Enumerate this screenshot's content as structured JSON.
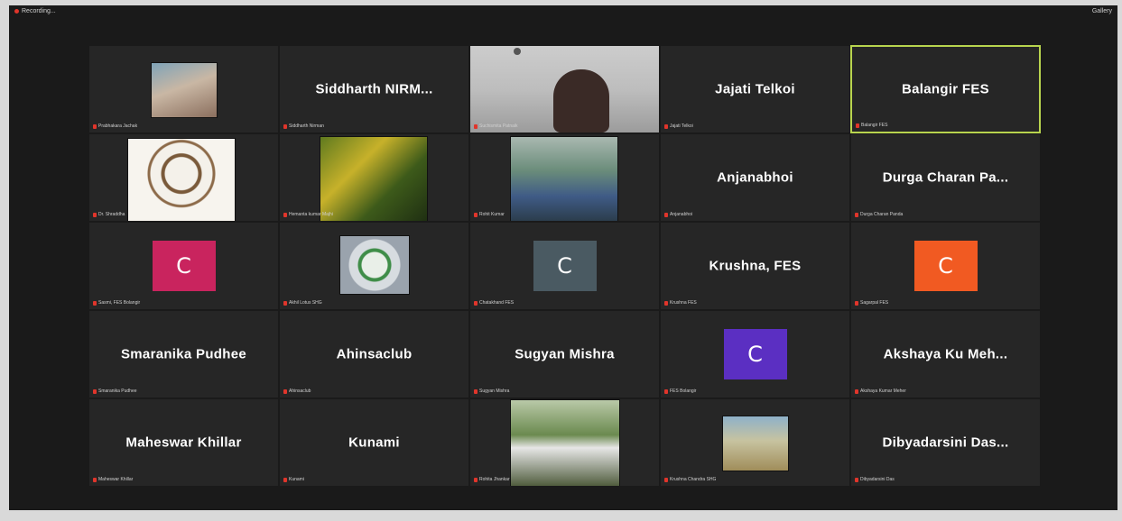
{
  "topbar": {
    "recording_label": "Recording...",
    "view_label": "Gallery"
  },
  "colors": {
    "active_speaker": "#b8d44e",
    "tile_bg": "#262626",
    "muted_mic": "#e0352b"
  },
  "tiles": [
    {
      "kind": "photo",
      "label": "Prabhakara Jachak",
      "photo": "person-portrait"
    },
    {
      "kind": "name",
      "display_name": "Siddharth  NIRM...",
      "label": "Siddharth Nirman"
    },
    {
      "kind": "video",
      "label": "Suchismita Patnaik",
      "active": false
    },
    {
      "kind": "name",
      "display_name": "Jajati Telkoi",
      "label": "Jajati Telkoi"
    },
    {
      "kind": "name",
      "display_name": "Balangir FES",
      "label": "Balangir FES",
      "active": true
    },
    {
      "kind": "photo",
      "label": "Dr. Shraddha",
      "photo": "emblem-logo"
    },
    {
      "kind": "photo",
      "label": "Hemanta kumar Majhi",
      "photo": "person-garden"
    },
    {
      "kind": "photo",
      "label": "Rohit Kumar",
      "photo": "person-sitting"
    },
    {
      "kind": "name",
      "display_name": "Anjanabhoi",
      "label": "Anjanabhoi"
    },
    {
      "kind": "name",
      "display_name": "Durga Charan Pa...",
      "label": "Durga Charan Panda"
    },
    {
      "kind": "letter",
      "letter": "C",
      "color": "#c9245e",
      "label": "Sasmi, FES Bolangir"
    },
    {
      "kind": "photo",
      "label": "Akhil Lotus SHG",
      "photo": "org-logo"
    },
    {
      "kind": "letter",
      "letter": "C",
      "color": "#4a5a62",
      "label": "Chatakhand FES"
    },
    {
      "kind": "name",
      "display_name": "Krushna, FES",
      "label": "Krushna FES"
    },
    {
      "kind": "letter",
      "letter": "C",
      "color": "#f15a22",
      "label": "Sagarpal FES"
    },
    {
      "kind": "name",
      "display_name": "Smaranika Pudhee",
      "label": "Smaranika Pudhee"
    },
    {
      "kind": "name",
      "display_name": "Ahinsaclub",
      "label": "Ahinsaclub"
    },
    {
      "kind": "name",
      "display_name": "Sugyan Mishra",
      "label": "Sugyan Mishra"
    },
    {
      "kind": "letter",
      "letter": "C",
      "color": "#5b2fc2",
      "label": "FES Bolangir"
    },
    {
      "kind": "name",
      "display_name": "Akshaya Ku Meh...",
      "label": "Akshaya Kumar Meher"
    },
    {
      "kind": "name",
      "display_name": "Maheswar Khillar",
      "label": "Maheswar Khillar"
    },
    {
      "kind": "name",
      "display_name": "Kunami",
      "label": "Kunami"
    },
    {
      "kind": "photo",
      "label": "Rohita Jhankar",
      "photo": "person-forest"
    },
    {
      "kind": "photo",
      "label": "Krushna Chandra SHG",
      "photo": "person-field"
    },
    {
      "kind": "name",
      "display_name": "Dibyadarsini  Das...",
      "label": "Dibyadarsini Das"
    }
  ]
}
